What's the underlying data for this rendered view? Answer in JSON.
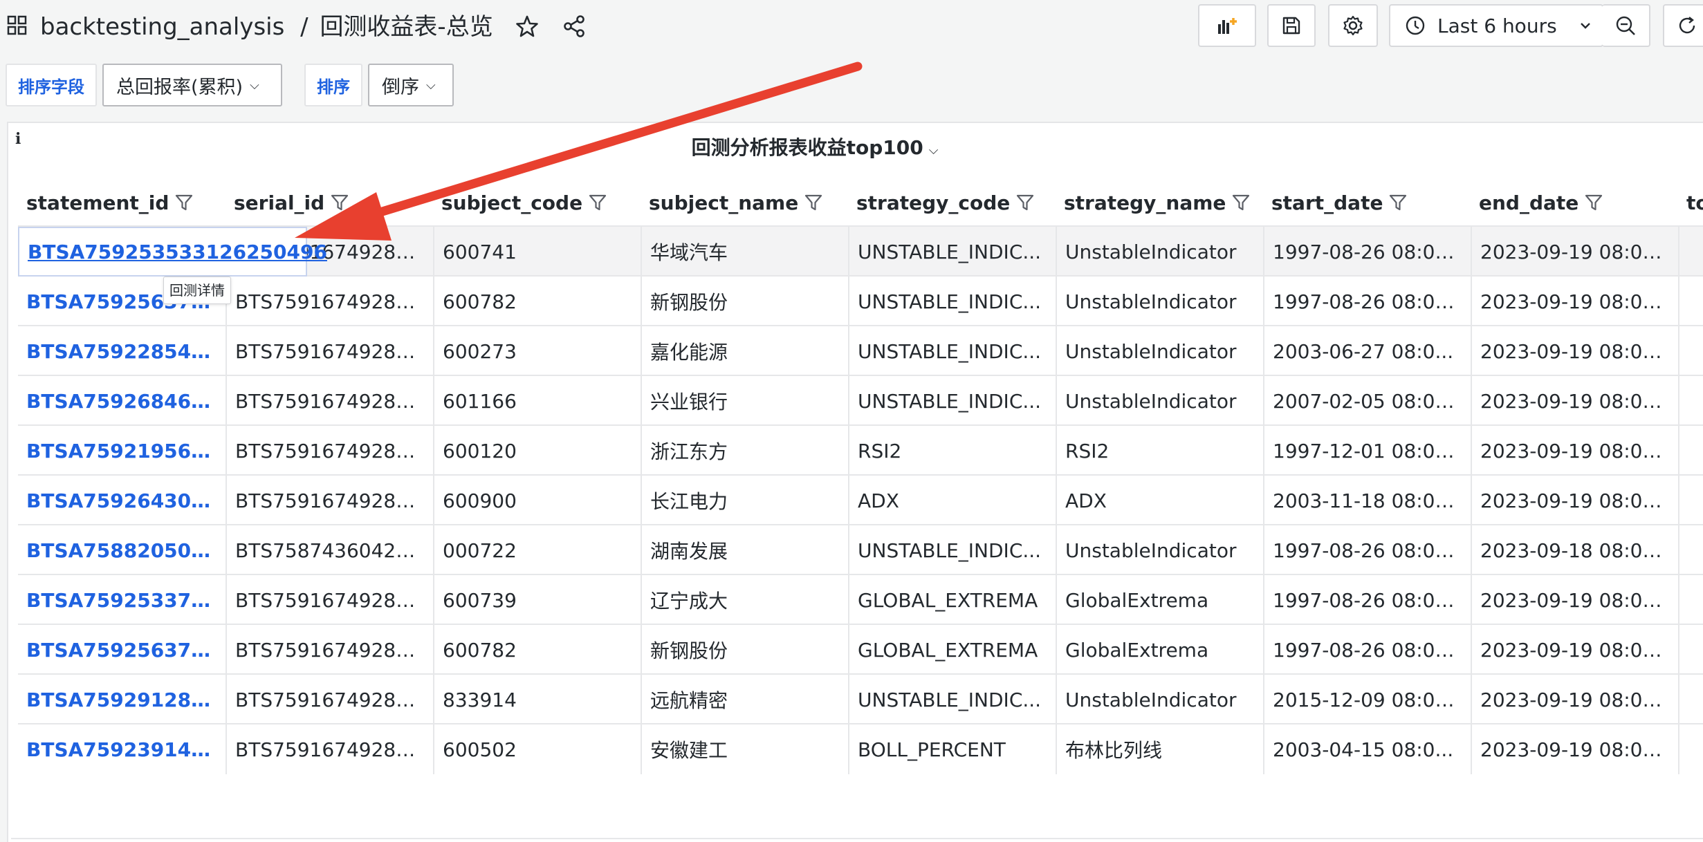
{
  "header": {
    "folder": "backtesting_analysis",
    "separator": "/",
    "dashboard_title": "回测收益表-总览",
    "time_range": "Last 6 hours"
  },
  "variables": {
    "sort_field_label": "排序字段",
    "sort_field_value": "总回报率(累积)",
    "order_label": "排序",
    "order_value": "倒序"
  },
  "panel": {
    "title": "回测分析报表收益top100",
    "info": "i",
    "tooltip": "回测详情"
  },
  "table": {
    "columns": [
      "statement_id",
      "serial_id",
      "subject_code",
      "subject_name",
      "strategy_code",
      "strategy_name",
      "start_date",
      "end_date",
      "to"
    ],
    "rows": [
      [
        "BTSA759253533126250496",
        "BTS75916749280...",
        "600741",
        "华域汽车",
        "UNSTABLE_INDIC...",
        "UnstableIndicator",
        "1997-08-26 08:00...",
        "2023-09-19 08:00..."
      ],
      [
        "BTSA7592563758...",
        "BTS75916749280...",
        "600782",
        "新钢股份",
        "UNSTABLE_INDIC...",
        "UnstableIndicator",
        "1997-08-26 08:00...",
        "2023-09-19 08:00..."
      ],
      [
        "BTSA7592285411...",
        "BTS75916749280...",
        "600273",
        "嘉化能源",
        "UNSTABLE_INDIC...",
        "UnstableIndicator",
        "2003-06-27 08:0...",
        "2023-09-19 08:00..."
      ],
      [
        "BTSA7592684601...",
        "BTS75916749280...",
        "601166",
        "兴业银行",
        "UNSTABLE_INDIC...",
        "UnstableIndicator",
        "2007-02-05 08:00...",
        "2023-09-19 08:00..."
      ],
      [
        "BTSA7592195694...",
        "BTS75916749280...",
        "600120",
        "浙江东方",
        "RSI2",
        "RSI2",
        "1997-12-01 08:00:...",
        "2023-09-19 08:00..."
      ],
      [
        "BTSA759264309...",
        "BTS75916749280...",
        "600900",
        "长江电力",
        "ADX",
        "ADX",
        "2003-11-18 08:00:...",
        "2023-09-19 08:00..."
      ],
      [
        "BTSA7588205072...",
        "BTS75874360424...",
        "000722",
        "湖南发展",
        "UNSTABLE_INDIC...",
        "UnstableIndicator",
        "1997-08-26 08:00...",
        "2023-09-18 08:00..."
      ],
      [
        "BTSA7592533791...",
        "BTS75916749280...",
        "600739",
        "辽宁成大",
        "GLOBAL_EXTREMA",
        "GlobalExtrema",
        "1997-08-26 08:00...",
        "2023-09-19 08:00..."
      ],
      [
        "BTSA7592563758...",
        "BTS75916749280...",
        "600782",
        "新钢股份",
        "GLOBAL_EXTREMA",
        "GlobalExtrema",
        "1997-08-26 08:00...",
        "2023-09-19 08:00..."
      ],
      [
        "BTSA7592912811...",
        "BTS75916749280...",
        "833914",
        "远航精密",
        "UNSTABLE_INDIC...",
        "UnstableIndicator",
        "2015-12-09 08:00...",
        "2023-09-19 08:00..."
      ],
      [
        "BTSA7592391442...",
        "BTS75916749280...",
        "600502",
        "安徽建工",
        "BOLL_PERCENT",
        "布林比列线",
        "2003-04-15 08:0...",
        "2023-09-19 08:00..."
      ]
    ]
  },
  "colors": {
    "link": "#1f62e0",
    "annotation_arrow": "#e8402f"
  }
}
